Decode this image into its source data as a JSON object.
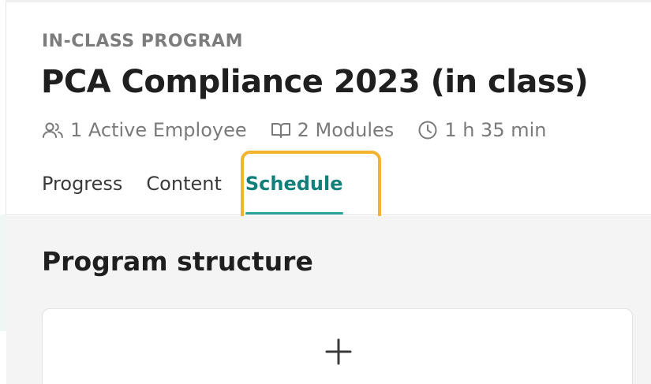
{
  "program": {
    "eyebrow": "IN-CLASS PROGRAM",
    "title": "PCA Compliance 2023 (in class)",
    "meta": {
      "employees": "1 Active Employee",
      "modules": "2 Modules",
      "duration": "1 h 35 min"
    }
  },
  "tabs": [
    {
      "label": "Progress",
      "active": false
    },
    {
      "label": "Content",
      "active": false
    },
    {
      "label": "Schedule",
      "active": true
    }
  ],
  "section": {
    "title": "Program structure"
  },
  "icons": {
    "employees": "users-icon",
    "modules": "book-open-icon",
    "duration": "clock-icon",
    "add": "plus-icon"
  },
  "colors": {
    "accent": "#137f7a",
    "tab_underline": "#2aa39b",
    "highlight": "#f2b430",
    "muted_text": "#7a7a7a"
  }
}
